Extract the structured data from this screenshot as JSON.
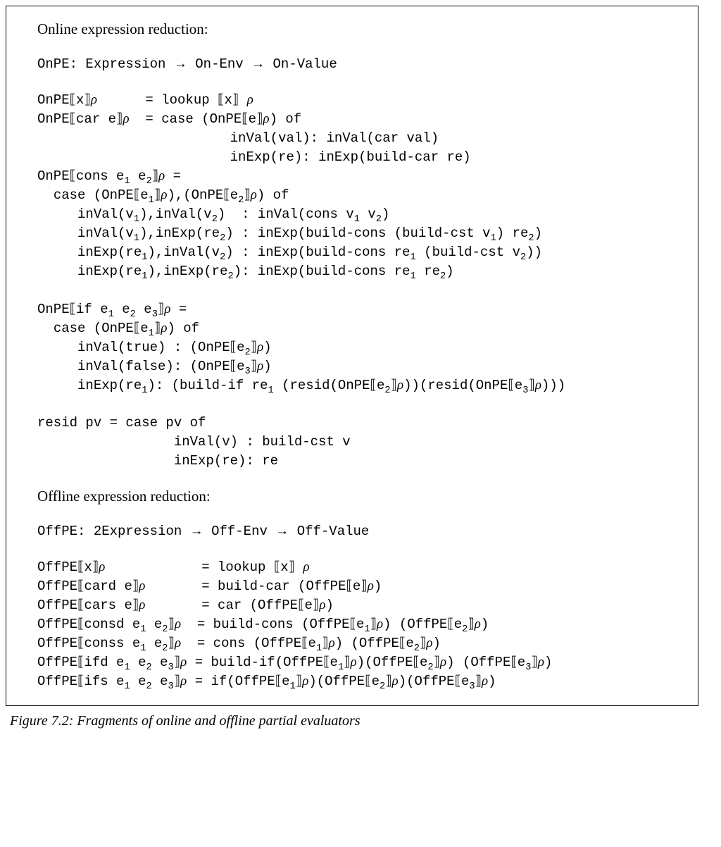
{
  "section1_title": "Online expression reduction:",
  "section2_title": "Offline expression reduction:",
  "caption": "Figure 7.2: Fragments of online and offline partial evaluators",
  "onpe_sig": {
    "name": "OnPE",
    "from": "Expression",
    "mid": "On-Env",
    "to": "On-Value"
  },
  "offpe_sig": {
    "name": "OffPE",
    "from": "2Expression",
    "mid": "Off-Env",
    "to": "Off-Value"
  },
  "on": {
    "l1_lhs": "OnPE",
    "l1_arg": "x",
    "l1_eq": "= lookup ",
    "l1_arg2": "x",
    "l2_lhs": "OnPE",
    "l2_arg": "car e",
    "l2_eq": "= case (OnPE",
    "l2_arg2": "e",
    "l2_tail": ") of",
    "l3": "inVal(val): inVal(car val)",
    "l4": "inExp(re): inExp(build-car re)",
    "l5_lhs": "OnPE",
    "l5_arg": "cons e",
    "l5_sub1": "1",
    "l5_e2": " e",
    "l5_sub2": "2",
    "l5_tail": " =",
    "l6_a": "case (OnPE",
    "l6_arg": "e",
    "l6_sub1": "1",
    "l6_b": "),(OnPE",
    "l6_arg2": "e",
    "l6_sub2": "2",
    "l6_c": ") of",
    "l7": "inVal(v",
    "l7s1": "1",
    "l7b": "),inVal(v",
    "l7s2": "2",
    "l7c": ")  : inVal(cons v",
    "l7s3": "1",
    "l7d": " v",
    "l7s4": "2",
    "l7e": ")",
    "l8": "inVal(v",
    "l8s1": "1",
    "l8b": "),inExp(re",
    "l8s2": "2",
    "l8c": ") : inExp(build-cons (build-cst v",
    "l8s3": "1",
    "l8d": ") re",
    "l8s4": "2",
    "l8e": ")",
    "l9": "inExp(re",
    "l9s1": "1",
    "l9b": "),inVal(v",
    "l9s2": "2",
    "l9c": ") : inExp(build-cons re",
    "l9s3": "1",
    "l9d": " (build-cst v",
    "l9s4": "2",
    "l9e": "))",
    "l10": "inExp(re",
    "l10s1": "1",
    "l10b": "),inExp(re",
    "l10s2": "2",
    "l10c": "): inExp(build-cons re",
    "l10s3": "1",
    "l10d": " re",
    "l10s4": "2",
    "l10e": ")",
    "if_lhs": "OnPE",
    "if_arg": "if e",
    "if_s1": "1",
    "if_e2": " e",
    "if_s2": "2",
    "if_e3": " e",
    "if_s3": "3",
    "if_tail": " =",
    "if_case_a": "case (OnPE",
    "if_case_arg": "e",
    "if_case_s": "1",
    "if_case_b": ") of",
    "if_t_a": "inVal(true) : (OnPE",
    "if_t_arg": "e",
    "if_t_s": "2",
    "if_t_b": ")",
    "if_f_a": "inVal(false): (OnPE",
    "if_f_arg": "e",
    "if_f_s": "3",
    "if_f_b": ")",
    "if_e_a": "inExp(re",
    "if_e_s1": "1",
    "if_e_b": "): (build-if re",
    "if_e_s1b": "1",
    "if_e_c": " (resid(OnPE",
    "if_e_arg2": "e",
    "if_e_s2": "2",
    "if_e_d": "))(resid(OnPE",
    "if_e_arg3": "e",
    "if_e_s3": "3",
    "if_e_e": ")))",
    "resid1": "resid pv = case pv of",
    "resid2": "inVal(v) : build-cst v",
    "resid3": "inExp(re): re"
  },
  "off": {
    "l1_lhs": "OffPE",
    "l1_arg": "x",
    "l1_rhs": "= lookup ",
    "l1_arg2": "x",
    "l2_lhs": "OffPE",
    "l2_arg": "card e",
    "l2_rhs": "= build-car (OffPE",
    "l2_arg2": "e",
    "l2_tail": ")",
    "l3_lhs": "OffPE",
    "l3_arg": "cars e",
    "l3_rhs": "= car (OffPE",
    "l3_arg2": "e",
    "l3_tail": ")",
    "l4_lhs": "OffPE",
    "l4_arg": "consd e",
    "l4_s1": "1",
    "l4_e2": " e",
    "l4_s2": "2",
    "l4_rhs": "= build-cons (OffPE",
    "l4_arg2": "e",
    "l4_rs1": "1",
    "l4_mid": ") (OffPE",
    "l4_arg3": "e",
    "l4_rs2": "2",
    "l4_tail": ")",
    "l5_lhs": "OffPE",
    "l5_arg": "conss e",
    "l5_s1": "1",
    "l5_e2": " e",
    "l5_s2": "2",
    "l5_rhs": "= cons (OffPE",
    "l5_arg2": "e",
    "l5_rs1": "1",
    "l5_mid": ") (OffPE",
    "l5_arg3": "e",
    "l5_rs2": "2",
    "l5_tail": ")",
    "l6_lhs": "OffPE",
    "l6_arg": "ifd e",
    "l6_s1": "1",
    "l6_e2": " e",
    "l6_s2": "2",
    "l6_e3": " e",
    "l6_s3": "3",
    "l6_rhs": "= build-if(OffPE",
    "l6_arg2": "e",
    "l6_rs1": "1",
    "l6_mid1": ")(OffPE",
    "l6_arg3": "e",
    "l6_rs2": "2",
    "l6_mid2": ") (OffPE",
    "l6_arg4": "e",
    "l6_rs3": "3",
    "l6_tail": ")",
    "l7_lhs": "OffPE",
    "l7_arg": "ifs e",
    "l7_s1": "1",
    "l7_e2": " e",
    "l7_s2": "2",
    "l7_e3": " e",
    "l7_s3": "3",
    "l7_rhs": "= if(OffPE",
    "l7_arg2": "e",
    "l7_rs1": "1",
    "l7_mid1": ")(OffPE",
    "l7_arg3": "e",
    "l7_rs2": "2",
    "l7_mid2": ")(OffPE",
    "l7_arg4": "e",
    "l7_rs3": "3",
    "l7_tail": ")"
  }
}
